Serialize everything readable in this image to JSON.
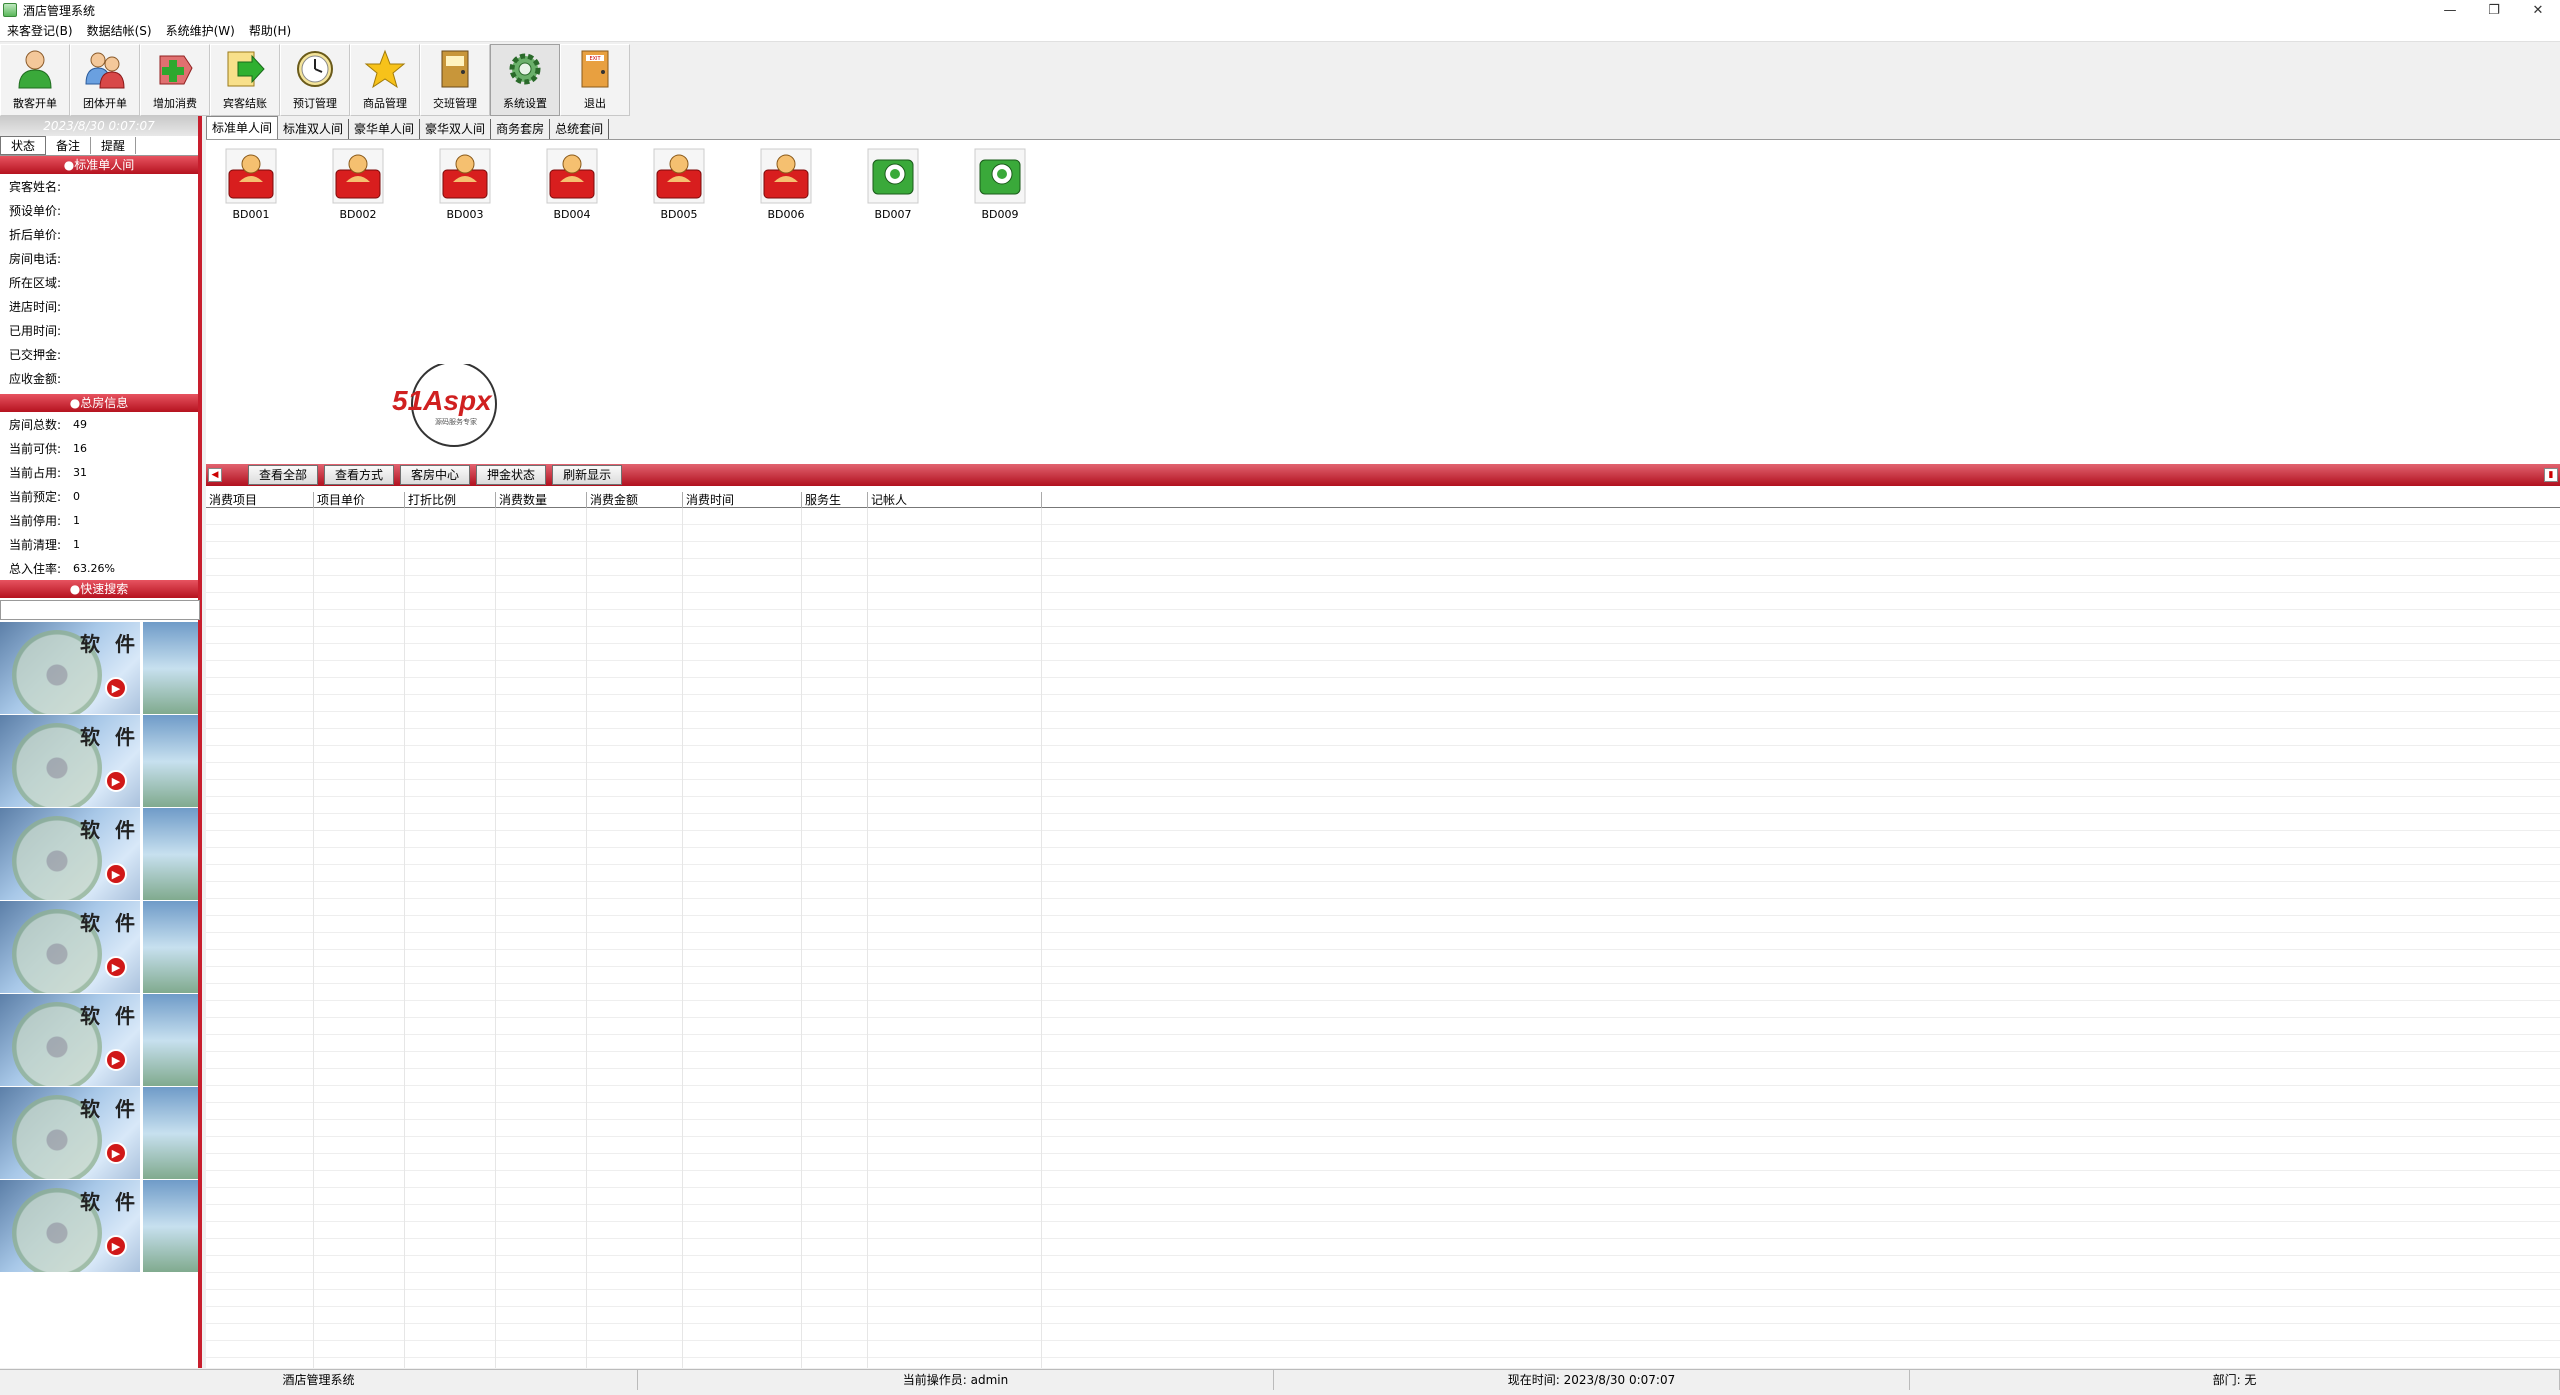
{
  "window": {
    "title": "酒店管理系统",
    "controls": [
      "—",
      "❐",
      "✕"
    ]
  },
  "menu": [
    "来客登记(B)",
    "数据结帐(S)",
    "系统维护(W)",
    "帮助(H)"
  ],
  "toolbar": [
    {
      "label": "散客开单",
      "icon": "guest-person-icon"
    },
    {
      "label": "团体开单",
      "icon": "group-people-icon"
    },
    {
      "label": "增加消费",
      "icon": "add-consumption-icon"
    },
    {
      "label": "宾客结账",
      "icon": "checkout-arrow-icon"
    },
    {
      "label": "预订管理",
      "icon": "clock-icon"
    },
    {
      "label": "商品管理",
      "icon": "star-icon"
    },
    {
      "label": "交班管理",
      "icon": "shift-door-icon"
    },
    {
      "label": "系统设置",
      "icon": "gear-icon"
    },
    {
      "label": "退出",
      "icon": "exit-icon"
    }
  ],
  "left": {
    "date": "2023/8/30 0:07:07",
    "tabs": [
      "状态",
      "备注",
      "提醒"
    ],
    "room_section": "●标准单人间",
    "room_fields": [
      "宾客姓名:",
      "预设单价:",
      "折后单价:",
      "房间电话:",
      "所在区域:",
      "进店时间:",
      "已用时间:",
      "已交押金:",
      "应收金额:"
    ],
    "total_section": "●总房信息",
    "totals": [
      {
        "label": "房间总数:",
        "value": "49"
      },
      {
        "label": "当前可供:",
        "value": "16"
      },
      {
        "label": "当前占用:",
        "value": "31"
      },
      {
        "label": "当前预定:",
        "value": "0"
      },
      {
        "label": "当前停用:",
        "value": "1"
      },
      {
        "label": "当前清理:",
        "value": "1"
      },
      {
        "label": "总入住率:",
        "value": "63.26%"
      }
    ],
    "search_section": "●快速搜索",
    "ad_text": "软 件"
  },
  "room_tabs": [
    "标准单人间",
    "标准双人间",
    "豪华单人间",
    "豪华双人间",
    "商务套房",
    "总统套间"
  ],
  "rooms": [
    {
      "name": "BD001",
      "status": "occupied"
    },
    {
      "name": "BD002",
      "status": "occupied"
    },
    {
      "name": "BD003",
      "status": "occupied"
    },
    {
      "name": "BD004",
      "status": "occupied"
    },
    {
      "name": "BD005",
      "status": "occupied"
    },
    {
      "name": "BD006",
      "status": "occupied"
    },
    {
      "name": "BD007",
      "status": "available"
    },
    {
      "name": "BD009",
      "status": "available"
    }
  ],
  "watermark": {
    "brand": "51Aspx",
    "sub": "源码服务专家"
  },
  "actions": [
    "查看全部",
    "查看方式",
    "客房中心",
    "押金状态",
    "刷新显示"
  ],
  "grid_columns": [
    "消费项目",
    "项目单价",
    "打折比例",
    "消费数量",
    "消费金额",
    "消费时间",
    "服务生",
    "记帐人"
  ],
  "status": {
    "app": "酒店管理系统",
    "operator": "当前操作员: admin",
    "time": "现在时间: 2023/8/30 0:07:07",
    "dept": "部门: 无"
  },
  "colors": {
    "accent": "#c81e2d",
    "occupied": "#d81e1e",
    "available": "#3aa93a"
  }
}
